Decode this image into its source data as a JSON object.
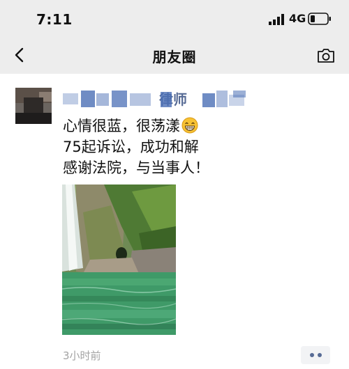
{
  "status_bar": {
    "time": "7:11",
    "network": "4G"
  },
  "nav": {
    "title": "朋友圈",
    "back_icon": "chevron-left-icon",
    "camera_icon": "camera-icon"
  },
  "post": {
    "author_visible_text": "律师",
    "lines": [
      "心情很蓝，很荡漾",
      "75起诉讼，成功和解",
      "感谢法院，与当事人！"
    ],
    "emoji": "grinning-face-emoji",
    "time": "3小时前",
    "name_color": "#576b95"
  }
}
